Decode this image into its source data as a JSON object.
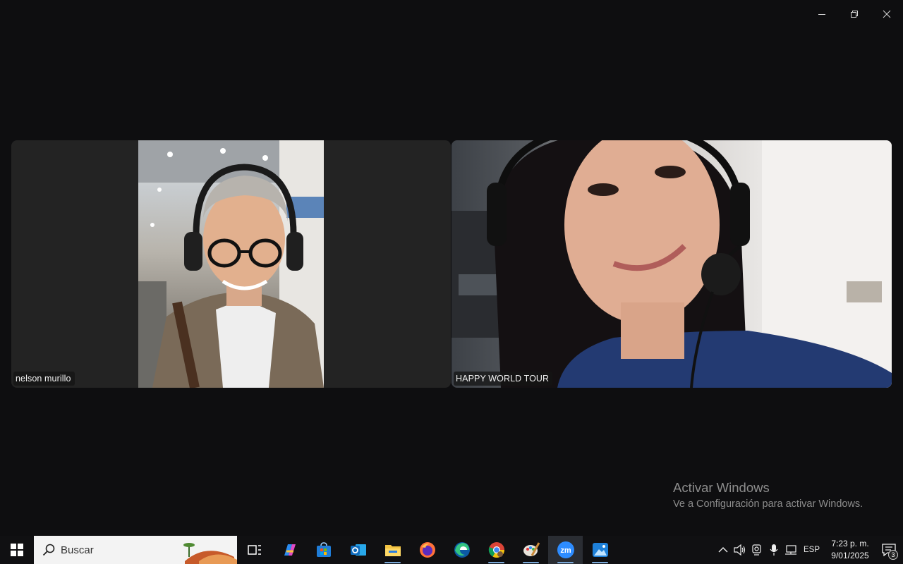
{
  "window": {
    "controls": [
      "minimize-icon",
      "restore-icon",
      "close-icon"
    ]
  },
  "participants": [
    {
      "name": "nelson murillo"
    },
    {
      "name": "HAPPY WORLD TOUR"
    }
  ],
  "watermark": {
    "title": "Activar Windows",
    "subtitle": "Ve a Configuración para activar Windows."
  },
  "taskbar": {
    "search_placeholder": "Buscar",
    "apps": [
      {
        "icon": "task-view-icon",
        "active": false
      },
      {
        "icon": "copilot-icon",
        "active": false
      },
      {
        "icon": "microsoft-store-icon",
        "active": false
      },
      {
        "icon": "outlook-icon",
        "active": false
      },
      {
        "icon": "file-explorer-icon",
        "active": true
      },
      {
        "icon": "firefox-icon",
        "active": false
      },
      {
        "icon": "edge-icon",
        "active": false
      },
      {
        "icon": "chrome-icon",
        "active": true
      },
      {
        "icon": "paint-icon",
        "active": true
      },
      {
        "icon": "zoom-icon",
        "active": true,
        "label": "zm"
      },
      {
        "icon": "photos-icon",
        "active": true
      }
    ],
    "tray": {
      "language": "ESP",
      "time": "7:23 p. m.",
      "date": "9/01/2025",
      "notifications": "3"
    }
  },
  "colors": {
    "background": "#0e0e10",
    "taskbar": "#101012",
    "zoom_blue": "#2d8cff",
    "watermark_text": "#8c8c8c"
  }
}
